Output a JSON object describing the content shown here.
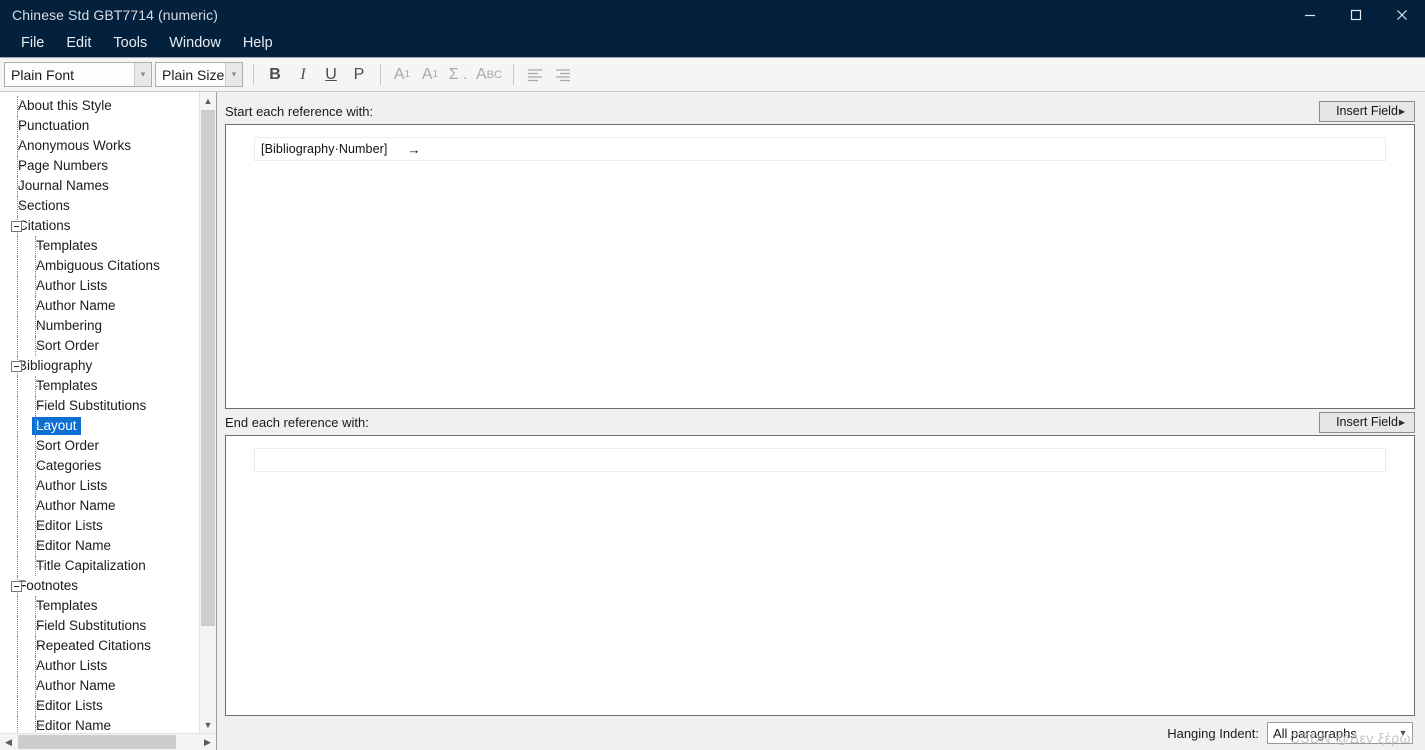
{
  "window": {
    "title": "Chinese Std GBT7714 (numeric)",
    "controls": [
      {
        "name": "minimize",
        "glyph": "minimize-icon"
      },
      {
        "name": "maximize",
        "glyph": "maximize-icon"
      },
      {
        "name": "close",
        "glyph": "close-icon"
      }
    ]
  },
  "menubar": {
    "items": [
      "File",
      "Edit",
      "Tools",
      "Window",
      "Help"
    ]
  },
  "toolbar": {
    "font_combo": {
      "value": "Plain Font"
    },
    "size_combo": {
      "value": "Plain Size"
    },
    "buttons": [
      {
        "name": "bold-button",
        "label": "B",
        "enabled": true
      },
      {
        "name": "italic-button",
        "label": "I",
        "enabled": true
      },
      {
        "name": "underline-button",
        "label": "U",
        "enabled": true
      },
      {
        "name": "plain-button",
        "label": "P",
        "enabled": true
      },
      {
        "name": "superscript-button",
        "label": "A",
        "sup": "1",
        "enabled": false
      },
      {
        "name": "subscript-button",
        "label": "A",
        "sub": "1",
        "enabled": false
      },
      {
        "name": "symbol-button",
        "label": "Σ .",
        "enabled": false
      },
      {
        "name": "small-caps-button",
        "label": "A",
        "caps": "BC",
        "enabled": false
      },
      {
        "name": "align-left-button",
        "label": "align-left-icon",
        "enabled": false
      },
      {
        "name": "align-right-button",
        "label": "align-right-icon",
        "enabled": false
      }
    ]
  },
  "sidebar": {
    "tree": [
      {
        "label": "About this Style",
        "level": 1,
        "expander": false,
        "selected": false
      },
      {
        "label": "Punctuation",
        "level": 1,
        "expander": false,
        "selected": false
      },
      {
        "label": "Anonymous Works",
        "level": 1,
        "expander": false,
        "selected": false
      },
      {
        "label": "Page Numbers",
        "level": 1,
        "expander": false,
        "selected": false
      },
      {
        "label": "Journal Names",
        "level": 1,
        "expander": false,
        "selected": false
      },
      {
        "label": "Sections",
        "level": 1,
        "expander": false,
        "selected": false
      },
      {
        "label": "Citations",
        "level": 1,
        "expander": true,
        "selected": false
      },
      {
        "label": "Templates",
        "level": 2,
        "expander": false,
        "selected": false
      },
      {
        "label": "Ambiguous Citations",
        "level": 2,
        "expander": false,
        "selected": false
      },
      {
        "label": "Author Lists",
        "level": 2,
        "expander": false,
        "selected": false
      },
      {
        "label": "Author Name",
        "level": 2,
        "expander": false,
        "selected": false
      },
      {
        "label": "Numbering",
        "level": 2,
        "expander": false,
        "selected": false
      },
      {
        "label": "Sort Order",
        "level": 2,
        "expander": false,
        "selected": false
      },
      {
        "label": "Bibliography",
        "level": 1,
        "expander": true,
        "selected": false
      },
      {
        "label": "Templates",
        "level": 2,
        "expander": false,
        "selected": false
      },
      {
        "label": "Field Substitutions",
        "level": 2,
        "expander": false,
        "selected": false
      },
      {
        "label": "Layout",
        "level": 2,
        "expander": false,
        "selected": true
      },
      {
        "label": "Sort Order",
        "level": 2,
        "expander": false,
        "selected": false
      },
      {
        "label": "Categories",
        "level": 2,
        "expander": false,
        "selected": false
      },
      {
        "label": "Author Lists",
        "level": 2,
        "expander": false,
        "selected": false
      },
      {
        "label": "Author Name",
        "level": 2,
        "expander": false,
        "selected": false
      },
      {
        "label": "Editor Lists",
        "level": 2,
        "expander": false,
        "selected": false
      },
      {
        "label": "Editor Name",
        "level": 2,
        "expander": false,
        "selected": false
      },
      {
        "label": "Title Capitalization",
        "level": 2,
        "expander": false,
        "selected": false
      },
      {
        "label": "Footnotes",
        "level": 1,
        "expander": true,
        "selected": false
      },
      {
        "label": "Templates",
        "level": 2,
        "expander": false,
        "selected": false
      },
      {
        "label": "Field Substitutions",
        "level": 2,
        "expander": false,
        "selected": false
      },
      {
        "label": "Repeated Citations",
        "level": 2,
        "expander": false,
        "selected": false
      },
      {
        "label": "Author Lists",
        "level": 2,
        "expander": false,
        "selected": false
      },
      {
        "label": "Author Name",
        "level": 2,
        "expander": false,
        "selected": false
      },
      {
        "label": "Editor Lists",
        "level": 2,
        "expander": false,
        "selected": false
      },
      {
        "label": "Editor Name",
        "level": 2,
        "expander": false,
        "selected": false
      }
    ]
  },
  "main": {
    "start_section": {
      "label": "Start each reference with:",
      "insert_field_label": "Insert Field",
      "content_line": "[Bibliography·Number]",
      "tab_mark": "→"
    },
    "end_section": {
      "label": "End each reference with:",
      "insert_field_label": "Insert Field",
      "content_line": ""
    }
  },
  "footer": {
    "hanging_indent_label": "Hanging Indent:",
    "hanging_indent_value": "All paragraphs"
  },
  "watermark": "CSDN @Δεν ξέρω",
  "colors": {
    "titlebar": "#03203c",
    "selection": "#0b6fd4",
    "panel_bg": "#f0f0f0",
    "editor_bg": "#ffffff"
  }
}
